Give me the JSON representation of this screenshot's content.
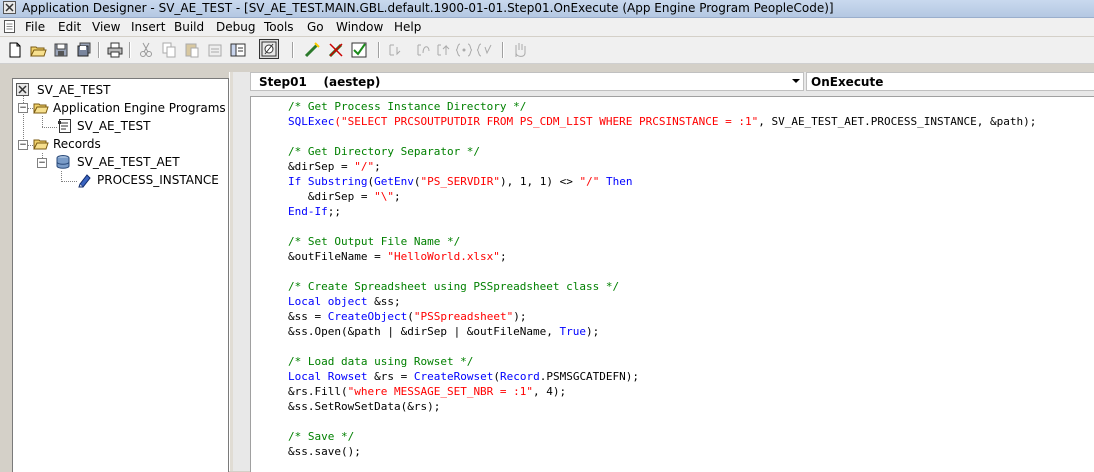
{
  "window": {
    "title": "Application Designer - SV_AE_TEST - [SV_AE_TEST.MAIN.GBL.default.1900-01-01.Step01.OnExecute (App Engine Program PeopleCode)]"
  },
  "menu": {
    "items": [
      "File",
      "Edit",
      "View",
      "Insert",
      "Build",
      "Debug",
      "Tools",
      "Go",
      "Window",
      "Help"
    ]
  },
  "toolbar": {
    "buttons": [
      "new-icon",
      "open-icon",
      "save-icon",
      "save-all-icon",
      "print-icon",
      "cut-icon",
      "copy-icon",
      "paste-icon",
      "properties-icon",
      "project-icon",
      "validate-icon",
      "compile-icon",
      "check-icon",
      "step-icon",
      "breakpoint-icon",
      "watch-icon",
      "local-icon",
      "hand-icon"
    ]
  },
  "tree": {
    "root": "SV_AE_TEST",
    "app_engine_programs": "Application Engine Programs",
    "program": "SV_AE_TEST",
    "records": "Records",
    "record": "SV_AE_TEST_AET",
    "field": "PROCESS_INSTANCE"
  },
  "editor": {
    "object_combo": "Step01    (aestep)",
    "event_combo": "OnExecute",
    "lines": [
      [
        [
          "cm",
          "/* Get Process Instance Directory */"
        ]
      ],
      [
        [
          "fn",
          "SQLExec"
        ],
        [
          "st",
          "(\"SELECT PRCSOUTPUTDIR FROM PS_CDM_LIST WHERE PRCSINSTANCE = :1\""
        ],
        [
          "pl",
          ", SV_AE_TEST_AET.PROCESS_INSTANCE, &path);"
        ]
      ],
      [],
      [
        [
          "cm",
          "/* Get Directory Separator */"
        ]
      ],
      [
        [
          "pl",
          "&dirSep = "
        ],
        [
          "st",
          "\"/\""
        ],
        [
          "pl",
          ";"
        ]
      ],
      [
        [
          "kw",
          "If "
        ],
        [
          "fn",
          "Substring"
        ],
        [
          "pl",
          "("
        ],
        [
          "fn",
          "GetEnv"
        ],
        [
          "pl",
          "("
        ],
        [
          "st",
          "\"PS_SERVDIR\""
        ],
        [
          "pl",
          "), 1, 1) <> "
        ],
        [
          "st",
          "\"/\""
        ],
        [
          "kw",
          " Then"
        ]
      ],
      [
        [
          "pl",
          "   &dirSep = "
        ],
        [
          "st",
          "\"\\\""
        ],
        [
          "pl",
          ";"
        ]
      ],
      [
        [
          "kw",
          "End-If"
        ],
        [
          "pl",
          ";;"
        ]
      ],
      [],
      [
        [
          "cm",
          "/* Set Output File Name */"
        ]
      ],
      [
        [
          "pl",
          "&outFileName = "
        ],
        [
          "st",
          "\"HelloWorld.xlsx\""
        ],
        [
          "pl",
          ";"
        ]
      ],
      [],
      [
        [
          "cm",
          "/* Create Spreadsheet using PSSpreadsheet class */"
        ]
      ],
      [
        [
          "kw",
          "Local object"
        ],
        [
          "pl",
          " &ss;"
        ]
      ],
      [
        [
          "pl",
          "&ss = "
        ],
        [
          "fn",
          "CreateObject"
        ],
        [
          "pl",
          "("
        ],
        [
          "st",
          "\"PSSpreadsheet\""
        ],
        [
          "pl",
          ");"
        ]
      ],
      [
        [
          "pl",
          "&ss.Open(&path | &dirSep | &outFileName, "
        ],
        [
          "kw",
          "True"
        ],
        [
          "pl",
          ");"
        ]
      ],
      [],
      [
        [
          "cm",
          "/* Load data using Rowset */"
        ]
      ],
      [
        [
          "kw",
          "Local Rowset"
        ],
        [
          "pl",
          " &rs = "
        ],
        [
          "fn",
          "CreateRowset"
        ],
        [
          "pl",
          "("
        ],
        [
          "kw",
          "Record"
        ],
        [
          "pl",
          ".PSMSGCATDEFN);"
        ]
      ],
      [
        [
          "pl",
          "&rs.Fill("
        ],
        [
          "st",
          "\"where MESSAGE_SET_NBR = :1\""
        ],
        [
          "pl",
          ", 4);"
        ]
      ],
      [
        [
          "pl",
          "&ss.SetRowSetData(&rs);"
        ]
      ],
      [],
      [
        [
          "cm",
          "/* Save */"
        ]
      ],
      [
        [
          "pl",
          "&ss.save();"
        ]
      ]
    ]
  }
}
